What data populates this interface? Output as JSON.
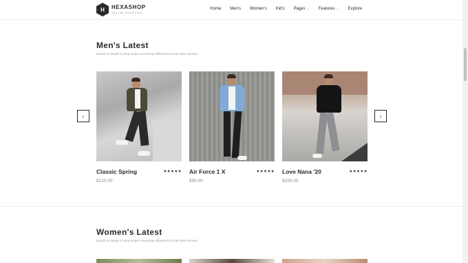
{
  "brand": {
    "name": "HEXASHOP",
    "tagline": "ONLINE SHOPPING",
    "mark": "H"
  },
  "nav": [
    {
      "label": "Home",
      "dropdown": false
    },
    {
      "label": "Men's",
      "dropdown": false
    },
    {
      "label": "Women's",
      "dropdown": false
    },
    {
      "label": "Kid's",
      "dropdown": false
    },
    {
      "label": "Pages",
      "dropdown": true
    },
    {
      "label": "Features",
      "dropdown": true
    },
    {
      "label": "Explore",
      "dropdown": false
    }
  ],
  "men_section": {
    "title": "Men's Latest",
    "subtitle": "Details to details is what makes Hexashop different from the other themes.",
    "products": [
      {
        "name": "Classic Spring",
        "price": "$120.00",
        "rating": 5,
        "stars": "★★★★★"
      },
      {
        "name": "Air Force 1 X",
        "price": "$90.00",
        "rating": 5,
        "stars": "★★★★★"
      },
      {
        "name": "Love Nana '20",
        "price": "$150.00",
        "rating": 5,
        "stars": "★★★★★"
      }
    ],
    "prev_icon": "‹",
    "next_icon": "›"
  },
  "women_section": {
    "title": "Women's Latest",
    "subtitle": "Details to details is what makes Hexashop different from the other themes."
  },
  "colors": {
    "text": "#2a2a2a",
    "muted": "#9a9a9a"
  }
}
